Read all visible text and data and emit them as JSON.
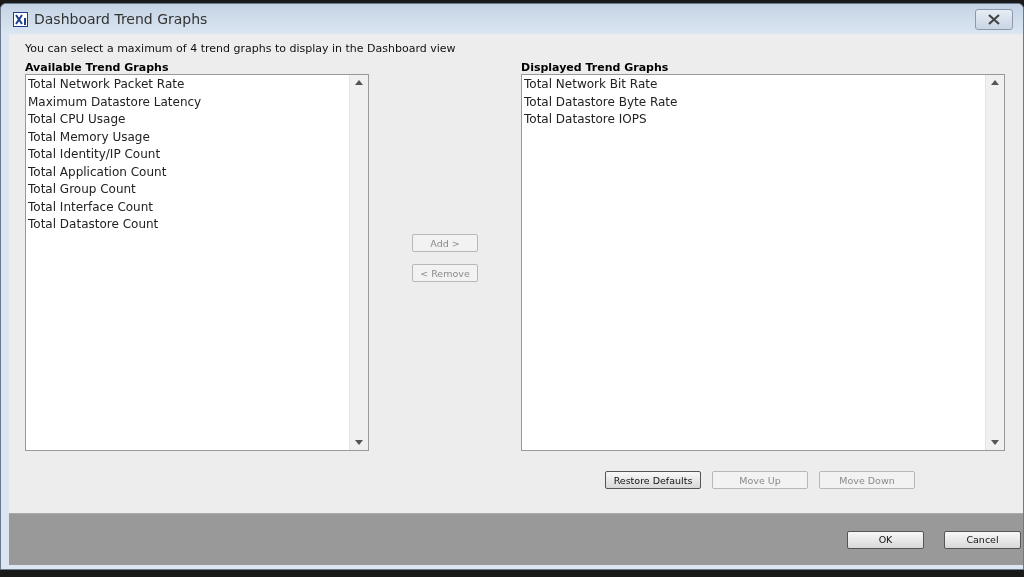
{
  "window": {
    "title": "Dashboard Trend Graphs"
  },
  "instructions": "You can select a maximum of 4 trend graphs to display in the Dashboard view",
  "available": {
    "label": "Available Trend Graphs",
    "items": [
      "Total Network Packet Rate",
      "Maximum Datastore Latency",
      "Total CPU Usage",
      "Total Memory Usage",
      "Total Identity/IP Count",
      "Total Application Count",
      "Total Group Count",
      "Total Interface Count",
      "Total Datastore Count"
    ]
  },
  "transfer_buttons": [
    {
      "label": "Add >",
      "disabled": true
    },
    {
      "label": "< Remove",
      "disabled": true
    }
  ],
  "displayed": {
    "label": "Displayed Trend Graphs",
    "items": [
      "Total Network Bit Rate",
      "Total Datastore Byte Rate",
      "Total Datastore IOPS"
    ]
  },
  "order_buttons": [
    {
      "label": "Restore Defaults",
      "disabled": false
    },
    {
      "label": "Move Up",
      "disabled": true
    },
    {
      "label": "Move Down",
      "disabled": true
    }
  ],
  "footer_buttons": [
    {
      "label": "OK",
      "disabled": false
    },
    {
      "label": "Cancel",
      "disabled": false
    }
  ]
}
